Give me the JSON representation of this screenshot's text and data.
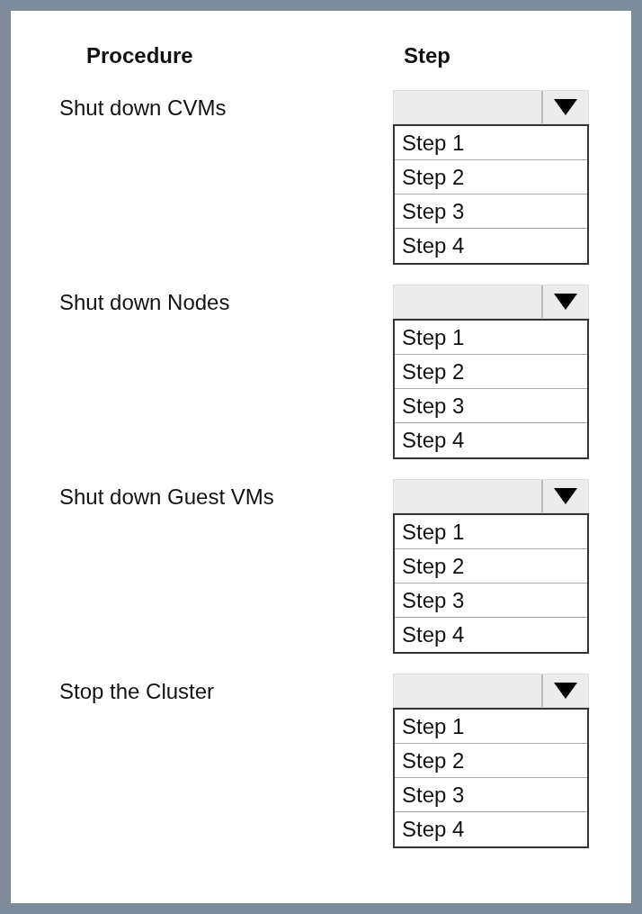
{
  "headers": [
    "Procedure",
    "Step"
  ],
  "procedures": [
    {
      "label": "Shut  down CVMs",
      "options": [
        "Step 1",
        "Step 2",
        "Step 3",
        "Step 4"
      ]
    },
    {
      "label": "Shut down Nodes",
      "options": [
        "Step 1",
        "Step 2",
        "Step 3",
        "Step 4"
      ]
    },
    {
      "label": "Shut down Guest VMs",
      "options": [
        "Step 1",
        "Step 2",
        "Step 3",
        "Step 4"
      ]
    },
    {
      "label": "Stop the Cluster",
      "options": [
        "Step 1",
        "Step 2",
        "Step 3",
        "Step 4"
      ]
    }
  ]
}
